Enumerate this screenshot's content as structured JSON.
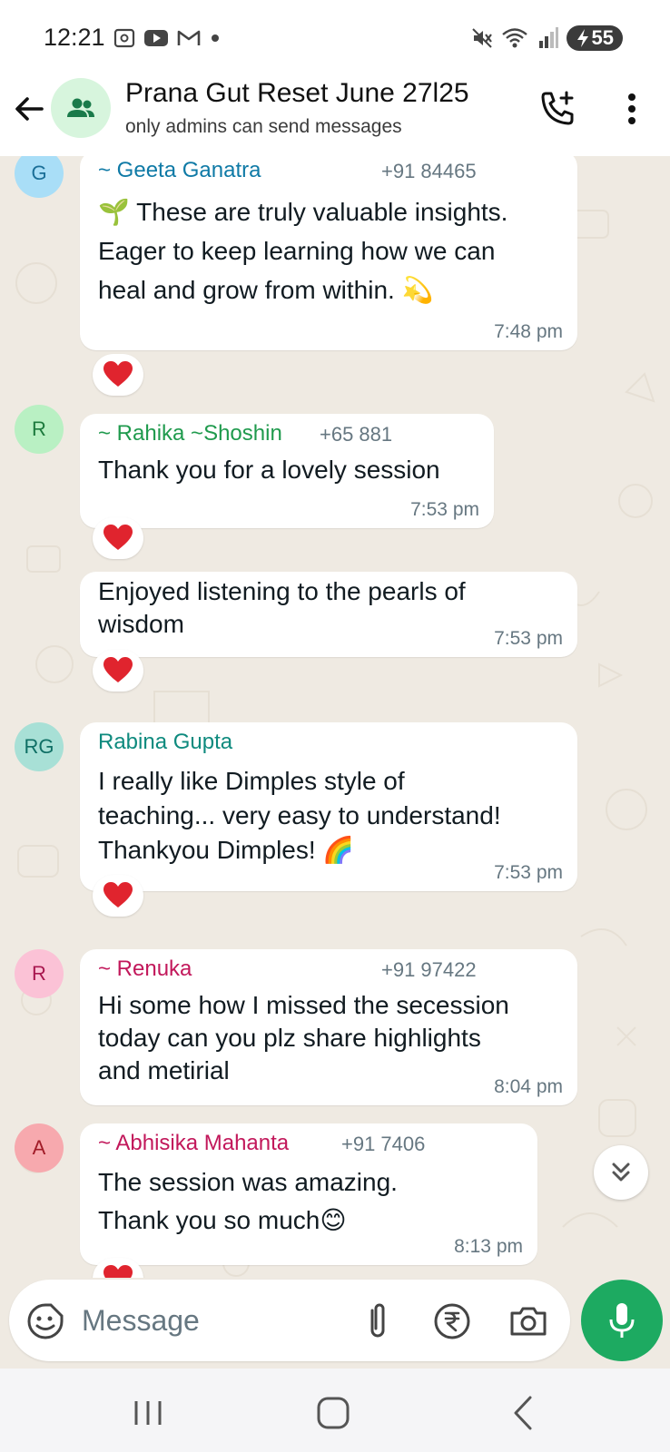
{
  "status_bar": {
    "time": "12:21",
    "battery": "55",
    "icons_left": [
      "screenshot-icon",
      "youtube-icon",
      "gmail-icon",
      "dot-icon"
    ],
    "icons_right": [
      "mute-icon",
      "wifi-icon",
      "signal-icon",
      "battery-icon"
    ]
  },
  "header": {
    "title": "Prana Gut Reset June 27l25",
    "subtitle": "only admins can send messages",
    "avatar_color": "#d7f5dd"
  },
  "messages": [
    {
      "sender": "~ Geeta Ganatra",
      "sender_color": "#0f7aa6",
      "phone": "+91 84465",
      "avatar": "G",
      "avatar_bg": "#a9def7",
      "avatar_fg": "#1a6e97",
      "lines": [
        "🌱 These are truly valuable insights.",
        "Eager to keep learning how we can",
        "heal and grow from within. 💫"
      ],
      "time": "7:48 pm",
      "reaction": "❤️"
    },
    {
      "sender": "~ Rahika ~Shoshin",
      "sender_color": "#1f9a4d",
      "phone": "+65 881",
      "avatar": "R",
      "avatar_bg": "#b9f0c3",
      "avatar_fg": "#1d7a3d",
      "lines": [
        "Thank you for a lovely session"
      ],
      "time": "7:53 pm",
      "reaction": "❤️"
    },
    {
      "sender": "",
      "lines": [
        "Enjoyed listening to the pearls of",
        "wisdom"
      ],
      "time": "7:53 pm",
      "reaction": "❤️"
    },
    {
      "sender": "Rabina Gupta",
      "sender_color": "#0e8a7e",
      "avatar": "RG",
      "avatar_bg": "#a8e0d6",
      "avatar_fg": "#0f6f65",
      "lines": [
        "I really like Dimples style of",
        "teaching... very easy to understand!",
        "Thankyou Dimples! 🌈"
      ],
      "time": "7:53 pm",
      "reaction": "❤️"
    },
    {
      "sender": "~ Renuka",
      "sender_color": "#c2185b",
      "phone": "+91 97422",
      "avatar": "R",
      "avatar_bg": "#fbc2d6",
      "avatar_fg": "#a8174f",
      "lines": [
        "Hi some how I missed the secession",
        "today can you plz share highlights",
        "and metirial"
      ],
      "time": "8:04 pm"
    },
    {
      "sender": "~ Abhisika Mahanta",
      "sender_color": "#c2185b",
      "phone": "+91 7406",
      "avatar": "A",
      "avatar_bg": "#f7a9ae",
      "avatar_fg": "#a11c28",
      "lines": [
        "The session was amazing.",
        "Thank you so much😊"
      ],
      "time": "8:13 pm"
    }
  ],
  "input": {
    "placeholder": "Message"
  },
  "colors": {
    "chat_bg": "#efeae2",
    "accent_green": "#1daa61",
    "heart": "#e0242e"
  }
}
